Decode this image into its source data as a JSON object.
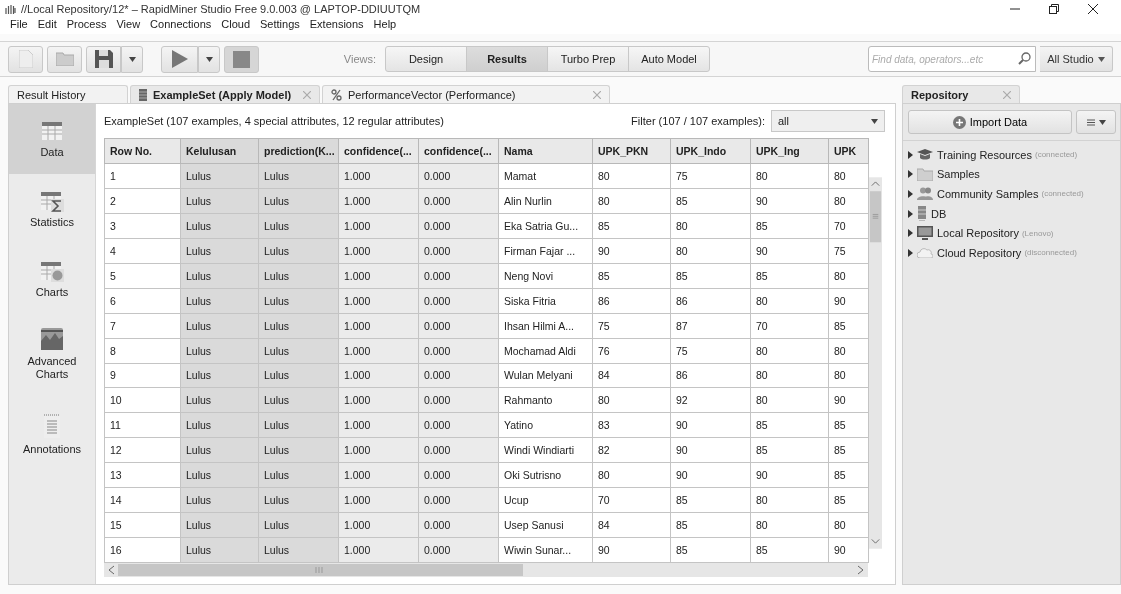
{
  "window": {
    "title": "//Local Repository/12* – RapidMiner Studio Free 9.0.003 @ LAPTOP-DDIUUTQM"
  },
  "menu": [
    "File",
    "Edit",
    "Process",
    "View",
    "Connections",
    "Cloud",
    "Settings",
    "Extensions",
    "Help"
  ],
  "toolbar": {
    "views_label": "Views:",
    "views": [
      {
        "label": "Design",
        "selected": false
      },
      {
        "label": "Results",
        "selected": true
      },
      {
        "label": "Turbo Prep",
        "selected": false
      },
      {
        "label": "Auto Model",
        "selected": false
      }
    ],
    "search": {
      "placeholder": "Find data, operators...etc"
    },
    "scope": "All Studio"
  },
  "result_tabs": [
    {
      "label": "Result History",
      "kind": "plain",
      "selected": false
    },
    {
      "label": "ExampleSet (Apply Model)",
      "kind": "table",
      "selected": true
    },
    {
      "label": "PerformanceVector (Performance)",
      "kind": "performance",
      "selected": false
    }
  ],
  "side_nav": [
    {
      "label": "Data",
      "kind": "data",
      "selected": true
    },
    {
      "label": "Statistics",
      "kind": "statistics",
      "selected": false
    },
    {
      "label": "Charts",
      "kind": "charts",
      "selected": false
    },
    {
      "label": "Advanced Charts",
      "kind": "advanced",
      "selected": false
    },
    {
      "label": "Annotations",
      "kind": "annotations",
      "selected": false
    }
  ],
  "summary": "ExampleSet (107 examples, 4 special attributes, 12 regular attributes)",
  "filter": {
    "label": "Filter (107 / 107 examples):",
    "value": "all"
  },
  "table": {
    "columns": [
      {
        "label": "Row No.",
        "kind": "regular"
      },
      {
        "label": "Kelulusan",
        "kind": "special"
      },
      {
        "label": "prediction(K...",
        "kind": "special"
      },
      {
        "label": "confidence(...",
        "kind": "confidence"
      },
      {
        "label": "confidence(...",
        "kind": "confidence"
      },
      {
        "label": "Nama",
        "kind": "regular"
      },
      {
        "label": "UPK_PKN",
        "kind": "regular"
      },
      {
        "label": "UPK_Indo",
        "kind": "regular"
      },
      {
        "label": "UPK_Ing",
        "kind": "regular"
      },
      {
        "label": "UPK",
        "kind": "regular"
      }
    ],
    "rows": [
      [
        "1",
        "Lulus",
        "Lulus",
        "1.000",
        "0.000",
        "Mamat",
        "80",
        "75",
        "80",
        "80"
      ],
      [
        "2",
        "Lulus",
        "Lulus",
        "1.000",
        "0.000",
        "Alin Nurlin",
        "80",
        "85",
        "90",
        "80"
      ],
      [
        "3",
        "Lulus",
        "Lulus",
        "1.000",
        "0.000",
        "Eka Satria Gu...",
        "85",
        "80",
        "85",
        "70"
      ],
      [
        "4",
        "Lulus",
        "Lulus",
        "1.000",
        "0.000",
        "Firman Fajar ...",
        "90",
        "80",
        "90",
        "75"
      ],
      [
        "5",
        "Lulus",
        "Lulus",
        "1.000",
        "0.000",
        "Neng Novi",
        "85",
        "85",
        "85",
        "80"
      ],
      [
        "6",
        "Lulus",
        "Lulus",
        "1.000",
        "0.000",
        "Siska Fitria",
        "86",
        "86",
        "80",
        "90"
      ],
      [
        "7",
        "Lulus",
        "Lulus",
        "1.000",
        "0.000",
        "Ihsan Hilmi A...",
        "75",
        "87",
        "70",
        "85"
      ],
      [
        "8",
        "Lulus",
        "Lulus",
        "1.000",
        "0.000",
        "Mochamad Aldi",
        "76",
        "75",
        "80",
        "80"
      ],
      [
        "9",
        "Lulus",
        "Lulus",
        "1.000",
        "0.000",
        "Wulan Melyani",
        "84",
        "86",
        "80",
        "80"
      ],
      [
        "10",
        "Lulus",
        "Lulus",
        "1.000",
        "0.000",
        "Rahmanto",
        "80",
        "92",
        "80",
        "90"
      ],
      [
        "11",
        "Lulus",
        "Lulus",
        "1.000",
        "0.000",
        "Yatino",
        "83",
        "90",
        "85",
        "85"
      ],
      [
        "12",
        "Lulus",
        "Lulus",
        "1.000",
        "0.000",
        "Windi Windiarti",
        "82",
        "90",
        "85",
        "85"
      ],
      [
        "13",
        "Lulus",
        "Lulus",
        "1.000",
        "0.000",
        "Oki Sutrisno",
        "80",
        "90",
        "90",
        "85"
      ],
      [
        "14",
        "Lulus",
        "Lulus",
        "1.000",
        "0.000",
        "Ucup",
        "70",
        "85",
        "80",
        "85"
      ],
      [
        "15",
        "Lulus",
        "Lulus",
        "1.000",
        "0.000",
        "Usep Sanusi",
        "84",
        "85",
        "80",
        "80"
      ],
      [
        "16",
        "Lulus",
        "Lulus",
        "1.000",
        "0.000",
        "Wiwin Sunar...",
        "90",
        "85",
        "85",
        "90"
      ]
    ]
  },
  "repository": {
    "tab": "Repository",
    "import_button": "Import Data",
    "items": [
      {
        "name": "Training Resources",
        "note": "(connected)",
        "kind": "training"
      },
      {
        "name": "Samples",
        "kind": "folder"
      },
      {
        "name": "Community Samples",
        "note": "(connected)",
        "kind": "community"
      },
      {
        "name": "DB",
        "kind": "db"
      },
      {
        "name": "Local Repository",
        "note": "(Lenovo)",
        "kind": "local"
      },
      {
        "name": "Cloud Repository",
        "note": "(disconnected)",
        "kind": "cloud"
      }
    ]
  }
}
